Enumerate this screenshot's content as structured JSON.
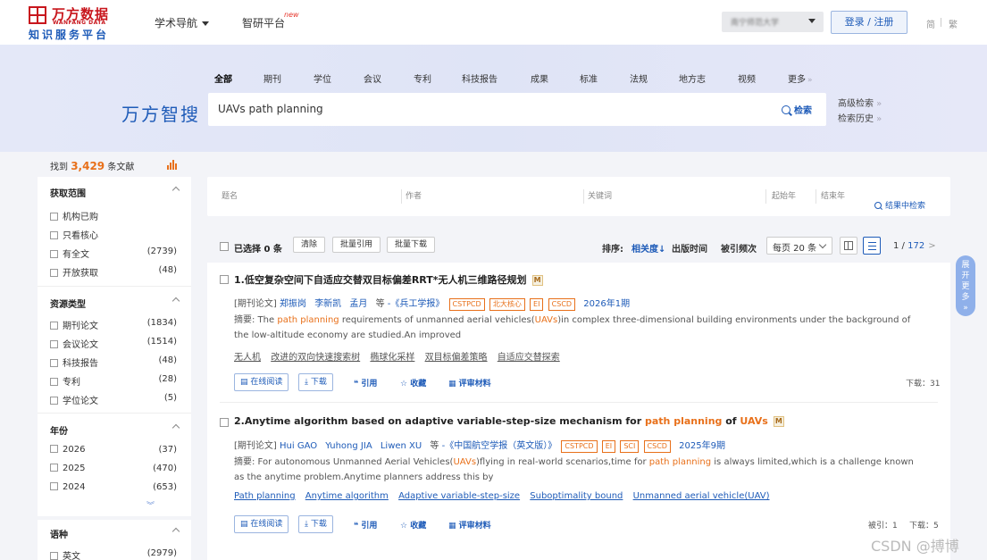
{
  "header": {
    "logo_cn": "万方数据",
    "logo_en": "WANFANG DATA",
    "logo_sub": "知识服务平台",
    "nav_academic": "学术导航",
    "nav_research": "智研平台",
    "new_badge": "new",
    "org_name": "南宁师范大学",
    "login": "登录 / 注册",
    "lang_simplified": "简",
    "lang_traditional": "繁"
  },
  "search": {
    "tabs": [
      "全部",
      "期刊",
      "学位",
      "会议",
      "专利",
      "科技报告",
      "成果",
      "标准",
      "法规",
      "地方志",
      "视频",
      "更多"
    ],
    "brand": "万方智搜",
    "query": "UAVs path planning",
    "button": "检索",
    "advanced": "高级检索",
    "history": "检索历史"
  },
  "summary": {
    "prefix": "找到",
    "count": "3,429",
    "suffix": "条文献"
  },
  "sidebar": {
    "scope": {
      "title": "获取范围",
      "items": [
        {
          "label": "机构已购",
          "count": ""
        },
        {
          "label": "只看核心",
          "count": ""
        },
        {
          "label": "有全文",
          "count": "(2739)"
        },
        {
          "label": "开放获取",
          "count": "(48)"
        }
      ]
    },
    "type": {
      "title": "资源类型",
      "items": [
        {
          "label": "期刊论文",
          "count": "(1834)"
        },
        {
          "label": "会议论文",
          "count": "(1514)"
        },
        {
          "label": "科技报告",
          "count": "(48)"
        },
        {
          "label": "专利",
          "count": "(28)"
        },
        {
          "label": "学位论文",
          "count": "(5)"
        }
      ]
    },
    "year": {
      "title": "年份",
      "items": [
        {
          "label": "2026",
          "count": "(37)"
        },
        {
          "label": "2025",
          "count": "(470)"
        },
        {
          "label": "2024",
          "count": "(653)"
        }
      ]
    },
    "language": {
      "title": "语种",
      "items": [
        {
          "label": "英文",
          "count": "(2979)"
        }
      ]
    }
  },
  "filters": {
    "title": "题名",
    "author": "作者",
    "keyword": "关键词",
    "start_year": "起始年",
    "end_year": "结束年",
    "search_in": "结果中检索"
  },
  "toolbar": {
    "selected": "已选择 0 条",
    "clear": "清除",
    "batch_cite": "批量引用",
    "batch_download": "批量下载",
    "sort_label": "排序:",
    "sort_relevance": "相关度↓",
    "sort_date": "出版时间",
    "sort_cited": "被引频次",
    "per_page": "每页 20 条",
    "page_current": "1",
    "page_total": "172"
  },
  "results": [
    {
      "title_prefix": "1.低空复杂空间下自适应交替双目标偏差RRT*无人机三维路径规划",
      "type": "[期刊论文]",
      "authors": [
        "郑振岗",
        "李新凯",
        "孟月"
      ],
      "etal": "等",
      "journal": "-《兵工学报》",
      "tags": [
        "CSTPCD",
        "北大核心",
        "EI",
        "CSCD"
      ],
      "year": "2026年1期",
      "abstract_label": "摘要:",
      "abstract_1": " The ",
      "abstract_hl1": "path planning",
      "abstract_2": " requirements of unmanned aerial vehicles(",
      "abstract_hl2": "UAVs",
      "abstract_3": ")in complex three-dimensional building environments under the background of the low-altitude economy are studied.An improved",
      "keywords": [
        "无人机",
        "改进的双向快速搜索树",
        "椭球化采样",
        "双目标偏差策略",
        "自适应交替探索"
      ],
      "downloads": "下载：31"
    },
    {
      "title_prefix": "2.Anytime algorithm based on adaptive variable-step-size mechanism for ",
      "title_hl1": "path planning",
      "title_mid": " of ",
      "title_hl2": "UAVs",
      "type": "[期刊论文]",
      "authors": [
        "Hui GAO",
        "Yuhong JIA",
        "Liwen XU"
      ],
      "etal": "等",
      "journal": "-《中国航空学报（英文版）》",
      "tags": [
        "CSTPCD",
        "EI",
        "SCI",
        "CSCD"
      ],
      "year": "2025年9期",
      "abstract_label": "摘要:",
      "abstract_1": " For autonomous Unmanned Aerial Vehicles(",
      "abstract_hl1": "UAVs",
      "abstract_2": ")flying in real-world scenarios,time for ",
      "abstract_hl2": "path planning",
      "abstract_3": " is always limited,which is a challenge known as the anytime problem.Anytime planners address this by",
      "keywords": [
        "Path planning",
        "Anytime algorithm",
        "Adaptive variable-step-size",
        "Suboptimality bound",
        "Unmanned aerial vehicle(UAV)"
      ],
      "cited": "被引：1",
      "downloads": "下载：5"
    }
  ],
  "actions": {
    "read_online": "在线阅读",
    "download": "下载",
    "cite": "引用",
    "favorite": "收藏",
    "review": "评审材料"
  },
  "float": {
    "expand": "展开更多"
  },
  "watermark": "CSDN @搏博"
}
